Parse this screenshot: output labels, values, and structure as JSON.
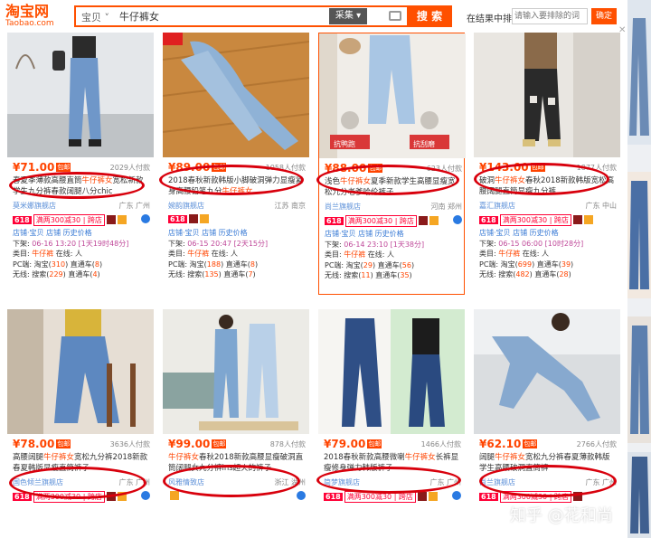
{
  "header": {
    "logo_cn": "淘宝网",
    "logo_en": "Taobao.com",
    "search_category": "宝贝",
    "search_query": "牛仔裤女",
    "collect_label": "采集",
    "search_button": "搜 索",
    "exclude_label": "在结果中排除",
    "exclude_placeholder": "请输入要排除的词",
    "confirm_button": "确定"
  },
  "labels": {
    "shop_store": "店铺",
    "shop_treasure": "宝贝",
    "shop_info": "店铺",
    "price_history": "历史价格",
    "down_prefix": "下架: ",
    "category_prefix": "类目: ",
    "online_prefix": "在线: ",
    "pc_prefix": "PC端: ",
    "mobile_prefix": "无线: ",
    "keyword_category": "牛仔裤",
    "online_value": "人",
    "pc_taobao": "淘宝(",
    "pc_direct": ") 直通车(",
    "mobile_search": "搜索(",
    "close_paren": ")",
    "mail_badge": "包邮",
    "tag_618": "618",
    "promo_text": "满两300减30 | 跨店",
    "card3_overlay_left": "抗鸭跑",
    "card3_overlay_right": "抗刮磨",
    "watermark": "知乎 @花和尚"
  },
  "row1": [
    {
      "price": "¥71.00",
      "sales": "2029人付款",
      "title_pre": "春夏季薄款高腰直筒",
      "title_kw": "牛仔裤女",
      "title_post": "宽松新款学生九分裤春款阔腿八分chic",
      "shop": "莫米娜旗舰店",
      "location": "广东 广州",
      "down": "06-16 13:20 [1天19时48分]",
      "pc_taobao": "310",
      "pc_direct": "8",
      "mobile_search": "229",
      "mobile_direct": "4"
    },
    {
      "price": "¥89.00",
      "sales": "1058人付款",
      "title_pre": "2018春秋新款韩版小脚破洞弹力显瘦紧身高腰铅笔九分",
      "title_kw": "牛仔裤女",
      "title_post": "",
      "shop": "婉韵旗舰店",
      "location": "江苏 南京",
      "down": "06-15 20:47 [2天15分]",
      "pc_taobao": "188",
      "pc_direct": "8",
      "mobile_search": "135",
      "mobile_direct": "7"
    },
    {
      "price": "¥88.00",
      "sales": "623人付款",
      "title_pre": "浅色",
      "title_kw": "牛仔裤女",
      "title_post": "夏季新款学生高腰显瘦宽松九分老爹哈伦裤子",
      "shop": "尚兰旗舰店",
      "location": "河南 郑州",
      "down": "06-14 23:10 [1天38分]",
      "pc_taobao": "29",
      "pc_direct": "56",
      "mobile_search": "11",
      "mobile_direct": "35"
    },
    {
      "price": "¥143.00",
      "sales": "1877人付款",
      "title_pre": "破洞",
      "title_kw": "牛仔裤女",
      "title_post": "春秋2018新款韩版宽松高腰阔腿直筒显瘦九分裤",
      "shop": "嘉汇旗舰店",
      "location": "广东 中山",
      "down": "06-15 06:00 [10时28分]",
      "pc_taobao": "699",
      "pc_direct": "39",
      "mobile_search": "482",
      "mobile_direct": "28"
    }
  ],
  "row2": [
    {
      "price": "¥78.00",
      "sales": "3636人付款",
      "title_pre": "高腰阔腿",
      "title_kw": "牛仔裤女",
      "title_post": "宽松九分裤2018新款春夏韩版显瘦直筒裤子",
      "shop": "国色倾兰旗舰店",
      "location": "广东 广州"
    },
    {
      "price": "¥99.00",
      "sales": "878人付款",
      "title_pre": "",
      "title_kw": "牛仔裤女",
      "title_post": "春秋2018新款高腰显瘦破洞直筒阔腿女九分裤ins超火的裤子",
      "shop": "风雅情致店",
      "location": "浙江 湖州"
    },
    {
      "price": "¥79.00",
      "sales": "1466人付款",
      "title_pre": "2018春秋新款高腰微喇",
      "title_kw": "牛仔裤女",
      "title_post": "长裤显瘦修身弹力韩版裤子",
      "shop": "简梦旗舰店",
      "location": "广东 广州"
    },
    {
      "price": "¥62.10",
      "sales": "2766人付款",
      "title_pre": "阔腿",
      "title_kw": "牛仔裤女",
      "title_post": "宽松九分裤春夏薄款韩版学生高腰破洞直筒裤",
      "shop": "尚兰旗舰店",
      "location": "广东 广州"
    }
  ]
}
